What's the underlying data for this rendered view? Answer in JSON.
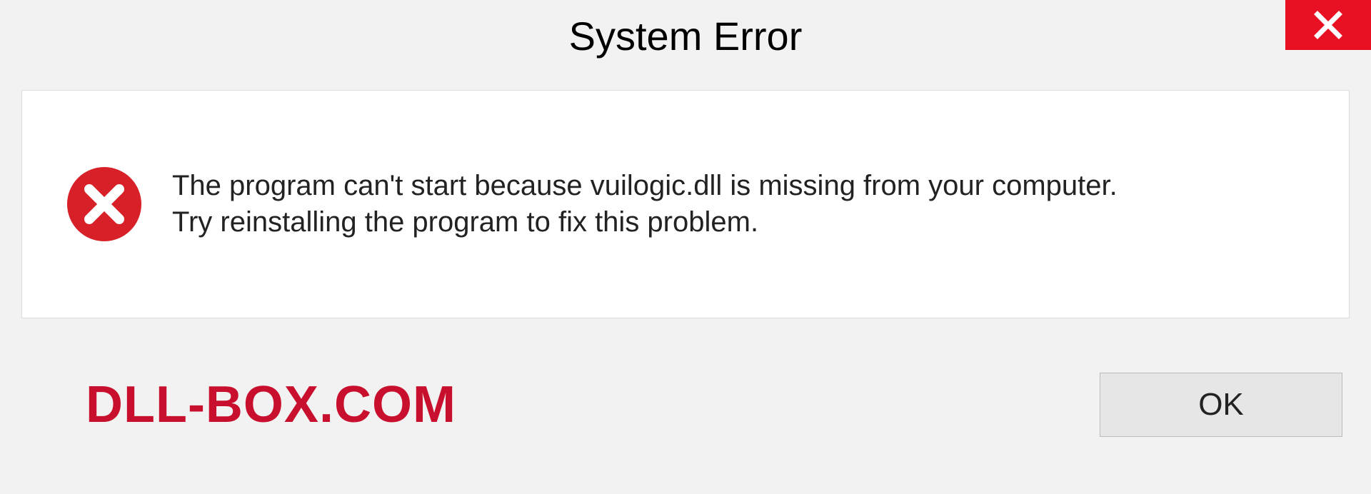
{
  "dialog": {
    "title": "System Error",
    "message": "The program can't start because vuilogic.dll is missing from your computer.\nTry reinstalling the program to fix this problem.",
    "ok_label": "OK"
  },
  "watermark": "DLL-BOX.COM",
  "colors": {
    "close_button": "#e81123",
    "error_icon": "#d72027",
    "watermark": "#c8102e"
  }
}
